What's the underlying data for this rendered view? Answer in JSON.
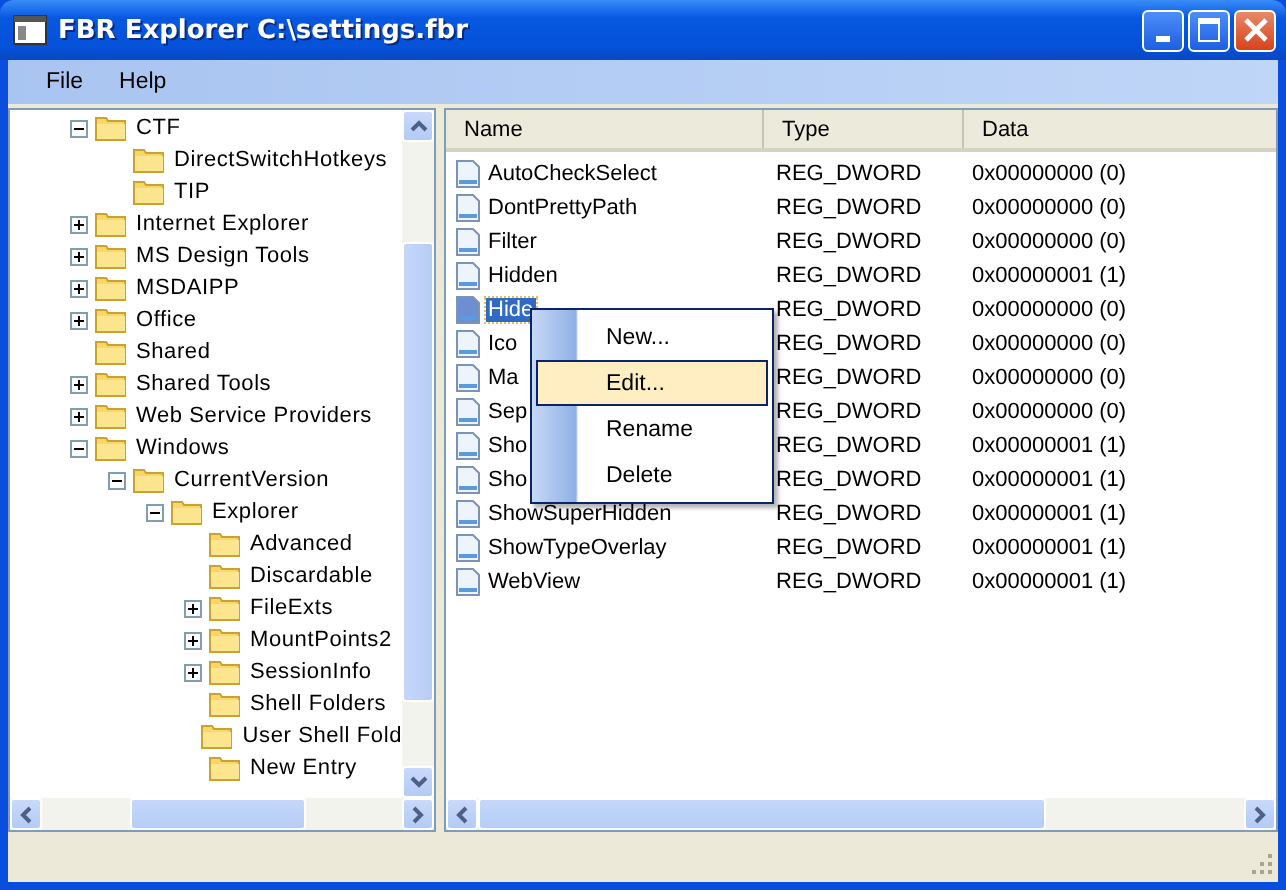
{
  "window": {
    "title": "FBR Explorer C:\\settings.fbr"
  },
  "menu": [
    "File",
    "Help"
  ],
  "tree": [
    {
      "label": "CTF",
      "expanded": true,
      "children": [
        {
          "label": "DirectSwitchHotkeys"
        },
        {
          "label": "TIP"
        }
      ]
    },
    {
      "label": "Internet Explorer",
      "expanded": false
    },
    {
      "label": "MS Design Tools",
      "expanded": false
    },
    {
      "label": "MSDAIPP",
      "expanded": false
    },
    {
      "label": "Office",
      "expanded": false
    },
    {
      "label": "Shared"
    },
    {
      "label": "Shared Tools",
      "expanded": false
    },
    {
      "label": "Web Service Providers",
      "expanded": false
    },
    {
      "label": "Windows",
      "expanded": true,
      "children": [
        {
          "label": "CurrentVersion",
          "expanded": true,
          "children": [
            {
              "label": "Explorer",
              "expanded": true,
              "children": [
                {
                  "label": "Advanced"
                },
                {
                  "label": "Discardable"
                },
                {
                  "label": "FileExts",
                  "expanded": false
                },
                {
                  "label": "MountPoints2",
                  "expanded": false
                },
                {
                  "label": "SessionInfo",
                  "expanded": false
                },
                {
                  "label": "Shell Folders"
                },
                {
                  "label": "User Shell Fold"
                },
                {
                  "label": "New Entry"
                }
              ]
            }
          ]
        }
      ]
    }
  ],
  "columns": [
    "Name",
    "Type",
    "Data"
  ],
  "rows": [
    {
      "name": "AutoCheckSelect",
      "type": "REG_DWORD",
      "data": "0x00000000 (0)",
      "selected": false
    },
    {
      "name": "DontPrettyPath",
      "type": "REG_DWORD",
      "data": "0x00000000 (0)",
      "selected": false
    },
    {
      "name": "Filter",
      "type": "REG_DWORD",
      "data": "0x00000000 (0)",
      "selected": false
    },
    {
      "name": "Hidden",
      "type": "REG_DWORD",
      "data": "0x00000001 (1)",
      "selected": false
    },
    {
      "name": "Hide",
      "type": "REG_DWORD",
      "data": "0x00000000 (0)",
      "selected": true
    },
    {
      "name": "Ico",
      "type": "REG_DWORD",
      "data": "0x00000000 (0)",
      "selected": false
    },
    {
      "name": "Ma",
      "type": "REG_DWORD",
      "data": "0x00000000 (0)",
      "selected": false
    },
    {
      "name": "Sep",
      "type": "REG_DWORD",
      "data": "0x00000000 (0)",
      "selected": false
    },
    {
      "name": "Sho",
      "type": "REG_DWORD",
      "data": "0x00000001 (1)",
      "selected": false
    },
    {
      "name": "Sho",
      "type": "REG_DWORD",
      "data": "0x00000001 (1)",
      "selected": false
    },
    {
      "name": "ShowSuperHidden",
      "type": "REG_DWORD",
      "data": "0x00000001 (1)",
      "selected": false
    },
    {
      "name": "ShowTypeOverlay",
      "type": "REG_DWORD",
      "data": "0x00000001 (1)",
      "selected": false
    },
    {
      "name": "WebView",
      "type": "REG_DWORD",
      "data": "0x00000001 (1)",
      "selected": false
    }
  ],
  "context_menu": [
    {
      "label": "New...",
      "selected": false
    },
    {
      "label": "Edit...",
      "selected": true
    },
    {
      "label": "Rename",
      "selected": false
    },
    {
      "label": "Delete",
      "selected": false
    }
  ]
}
